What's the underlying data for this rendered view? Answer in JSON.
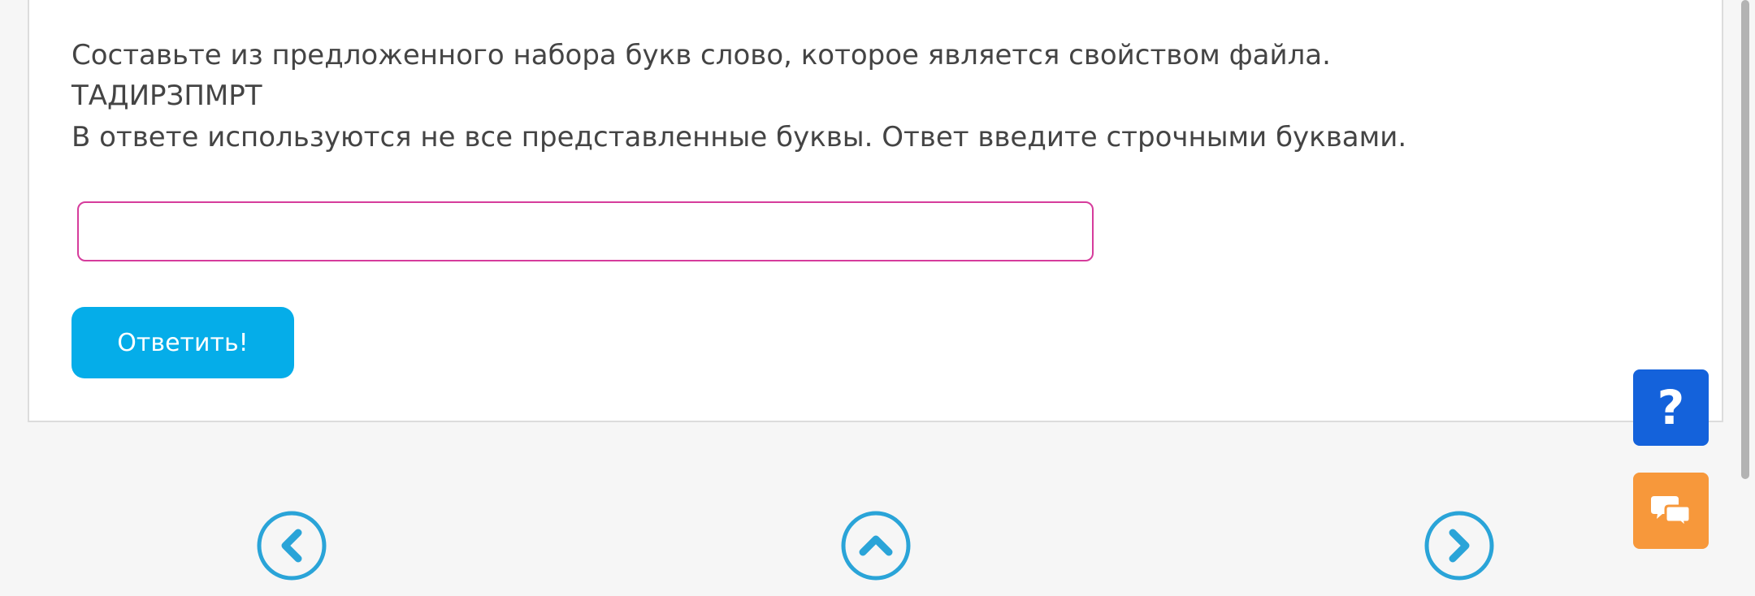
{
  "question": {
    "line1": "Составьте из предложенного набора букв слово, которое является свойством файла.",
    "letters": "ТАДИРЗПМРТ",
    "line3": "В ответе используются не все представленные буквы. Ответ введите строчными буквами."
  },
  "answer": {
    "value": "",
    "placeholder": ""
  },
  "submit_label": "Ответить!",
  "help_label": "?",
  "icons": {
    "prev": "chevron-left-icon",
    "up": "chevron-up-icon",
    "next": "chevron-right-icon",
    "chat": "chat-bubbles-icon"
  },
  "colors": {
    "accent": "#05ade9",
    "input_border": "#d63c9c",
    "help": "#1462db",
    "chat": "#f7983b",
    "nav": "#2aa4d8",
    "text": "#444444"
  }
}
